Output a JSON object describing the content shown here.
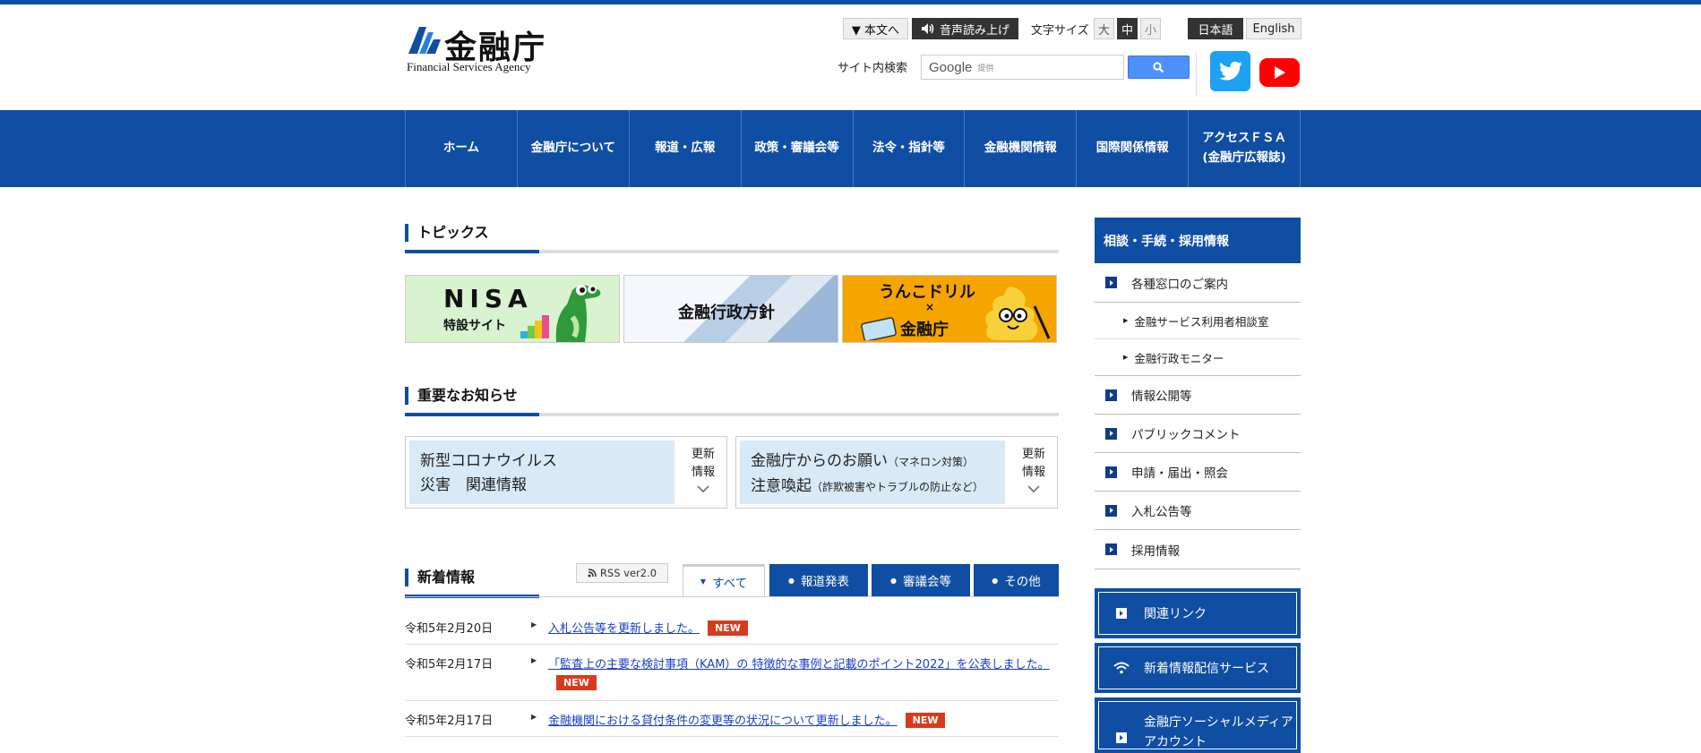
{
  "header": {
    "logo_jp": "金融庁",
    "logo_en": "Financial Services Agency",
    "main_content_label": "▼ 本文へ",
    "voice_label": "音声読み上げ",
    "font_size_label": "文字サイズ",
    "font_sizes": [
      "大",
      "中",
      "小"
    ],
    "lang_ja": "日本語",
    "lang_en": "English",
    "search_label": "サイト内検索",
    "search_google": "Google",
    "search_provided": "提供"
  },
  "nav": {
    "items": [
      "ホーム",
      "金融庁について",
      "報道・広報",
      "政策・審議会等",
      "法令・指針等",
      "金融機関情報",
      "国際関係情報",
      "アクセスＦＳＡ\n(金融庁広報誌)"
    ]
  },
  "topics": {
    "title": "トピックス",
    "banners": [
      {
        "line1": "NISA",
        "line2": "特設サイト"
      },
      {
        "line1": "金融行政方針"
      },
      {
        "line1": "うんこドリル",
        "line2": "×",
        "line3": "金融庁"
      }
    ]
  },
  "notices": {
    "title": "重要なお知らせ",
    "items": [
      {
        "line1": "新型コロナウイルス",
        "line2": "災害　関連情報",
        "update": "更新\n情報"
      },
      {
        "line1": "金融庁からのお願い",
        "line1_small": "（マネロン対策）",
        "line2": "注意喚起",
        "line2_small": "（詐欺被害やトラブルの防止など）",
        "update": "更新\n情報"
      }
    ]
  },
  "news": {
    "title": "新着情報",
    "rss_label": "RSS ver2.0",
    "tabs": [
      "すべて",
      "報道発表",
      "審議会等",
      "その他"
    ],
    "new_badge": "NEW",
    "items": [
      {
        "date": "令和5年2月20日",
        "text": "入札公告等を更新しました。"
      },
      {
        "date": "令和5年2月17日",
        "text": "「監査上の主要な検討事項（KAM）の 特徴的な事例と記載のポイント2022」を公表しました。"
      },
      {
        "date": "令和5年2月17日",
        "text": "金融機関における貸付条件の変更等の状況について更新しました。"
      }
    ]
  },
  "sidebar": {
    "head": "相談・手続・採用情報",
    "items": [
      "各種窓口のご案内",
      "情報公開等",
      "パブリックコメント",
      "申請・届出・照会",
      "入札公告等",
      "採用情報"
    ],
    "sub_items": [
      "金融サービス利用者相談室",
      "金融行政モニター"
    ],
    "boxes": [
      "関連リンク",
      "新着情報配信サービス",
      "金融庁ソーシャルメディアアカウント"
    ]
  },
  "colors": {
    "brand_blue": "#0f4ea3",
    "new_badge": "#d83a1e",
    "twitter": "#1da1f2",
    "youtube": "#ff0000"
  }
}
